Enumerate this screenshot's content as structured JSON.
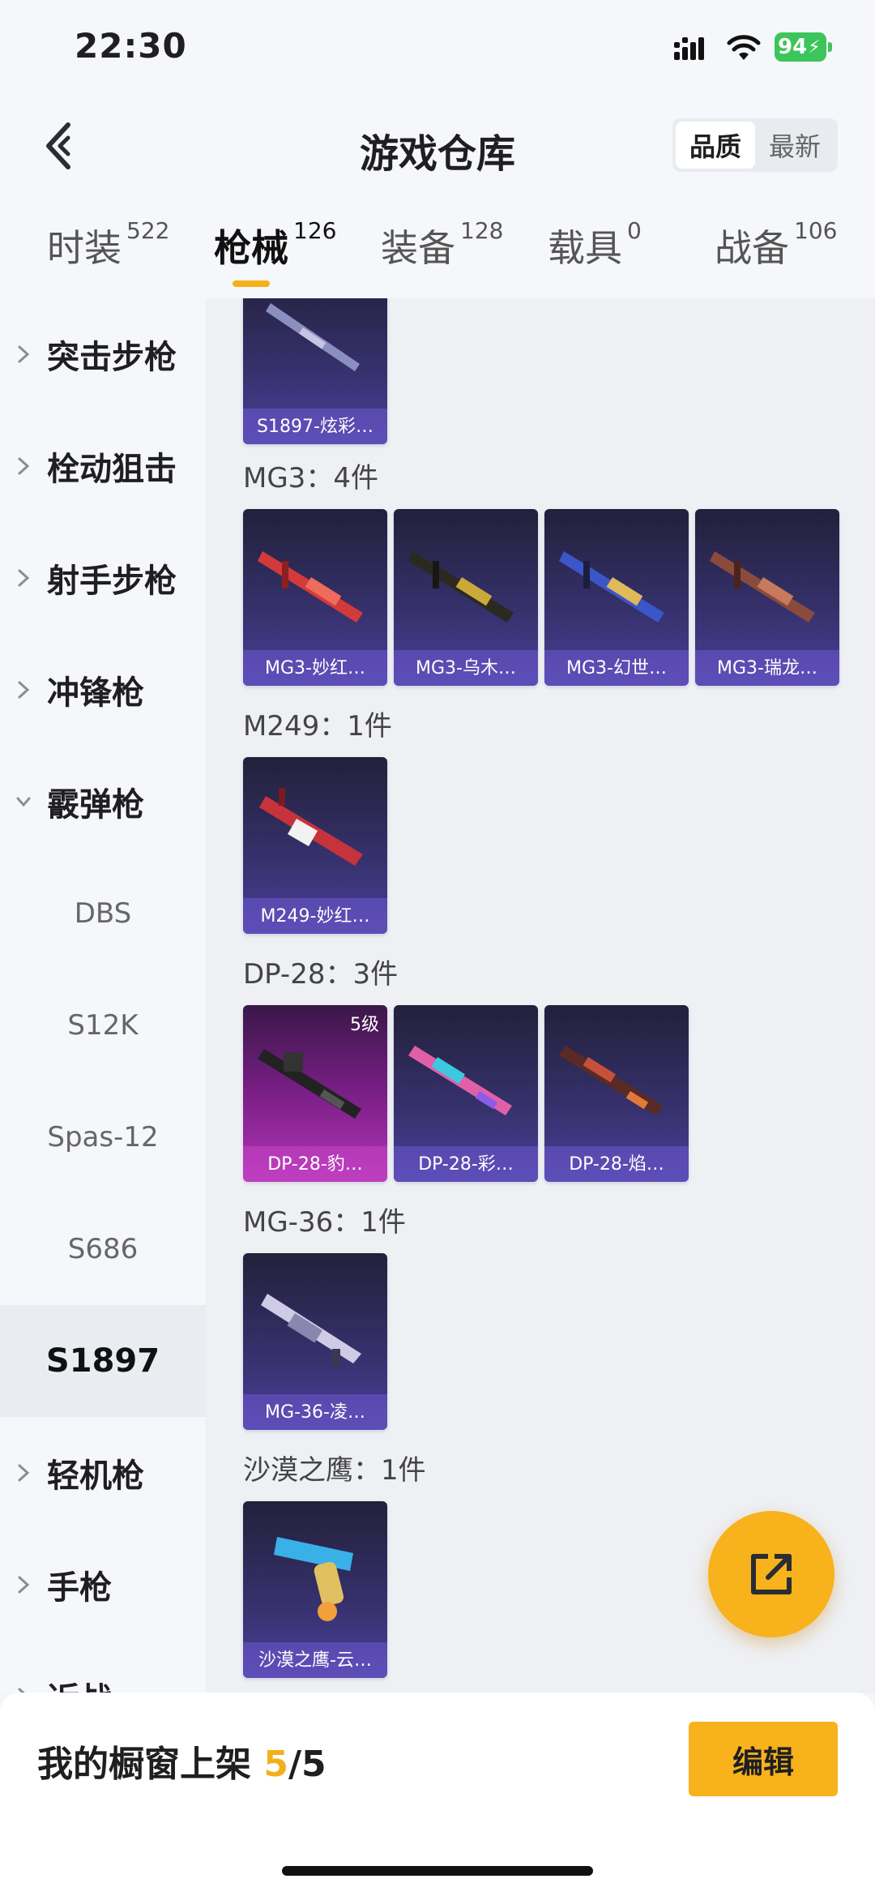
{
  "status_bar": {
    "time": "22:30",
    "battery": "94"
  },
  "header": {
    "title": "游戏仓库",
    "sort_quality": "品质",
    "sort_newest": "最新"
  },
  "tabs": [
    {
      "name": "时装",
      "count": "522"
    },
    {
      "name": "枪械",
      "count": "126"
    },
    {
      "name": "装备",
      "count": "128"
    },
    {
      "name": "载具",
      "count": "0"
    },
    {
      "name": "战备",
      "count": "106"
    }
  ],
  "sidebar": {
    "categories": [
      "突击步枪",
      "栓动狙击",
      "射手步枪",
      "冲锋枪",
      "霰弹枪",
      "轻机枪",
      "手枪",
      "近战"
    ],
    "sub_items": [
      "DBS",
      "S12K",
      "Spas-12",
      "S686",
      "S1897"
    ]
  },
  "groups": [
    {
      "label": "MG3：4件"
    },
    {
      "label": "M249：1件"
    },
    {
      "label": "DP-28：3件"
    },
    {
      "label": "MG-36：1件"
    },
    {
      "label": "沙漠之鹰：1件"
    }
  ],
  "cards": {
    "s1897": "S1897-炫彩…",
    "mg3_1": "MG3-妙红…",
    "mg3_2": "MG3-乌木…",
    "mg3_3": "MG3-幻世…",
    "mg3_4": "MG3-瑞龙…",
    "m249_1": "M249-妙红…",
    "dp28_1": "DP-28-豹…",
    "dp28_1_level": "5级",
    "dp28_2": "DP-28-彩…",
    "dp28_3": "DP-28-焰…",
    "mg36_1": "MG-36-凌…",
    "deagle_1": "沙漠之鹰-云…"
  },
  "bottom": {
    "showcase_label": "我的橱窗上架 ",
    "showcase_current": "5",
    "showcase_total": "/5",
    "edit_label": "编辑"
  },
  "colors": {
    "accent": "#f7b21c",
    "card_bg": "#35306a",
    "card_pink": "#b335b6",
    "battery": "#3cc55a"
  },
  "icons": [
    "back-icon",
    "signal-icon",
    "wifi-icon",
    "chevron-right-icon",
    "chevron-down-icon",
    "share-icon"
  ]
}
